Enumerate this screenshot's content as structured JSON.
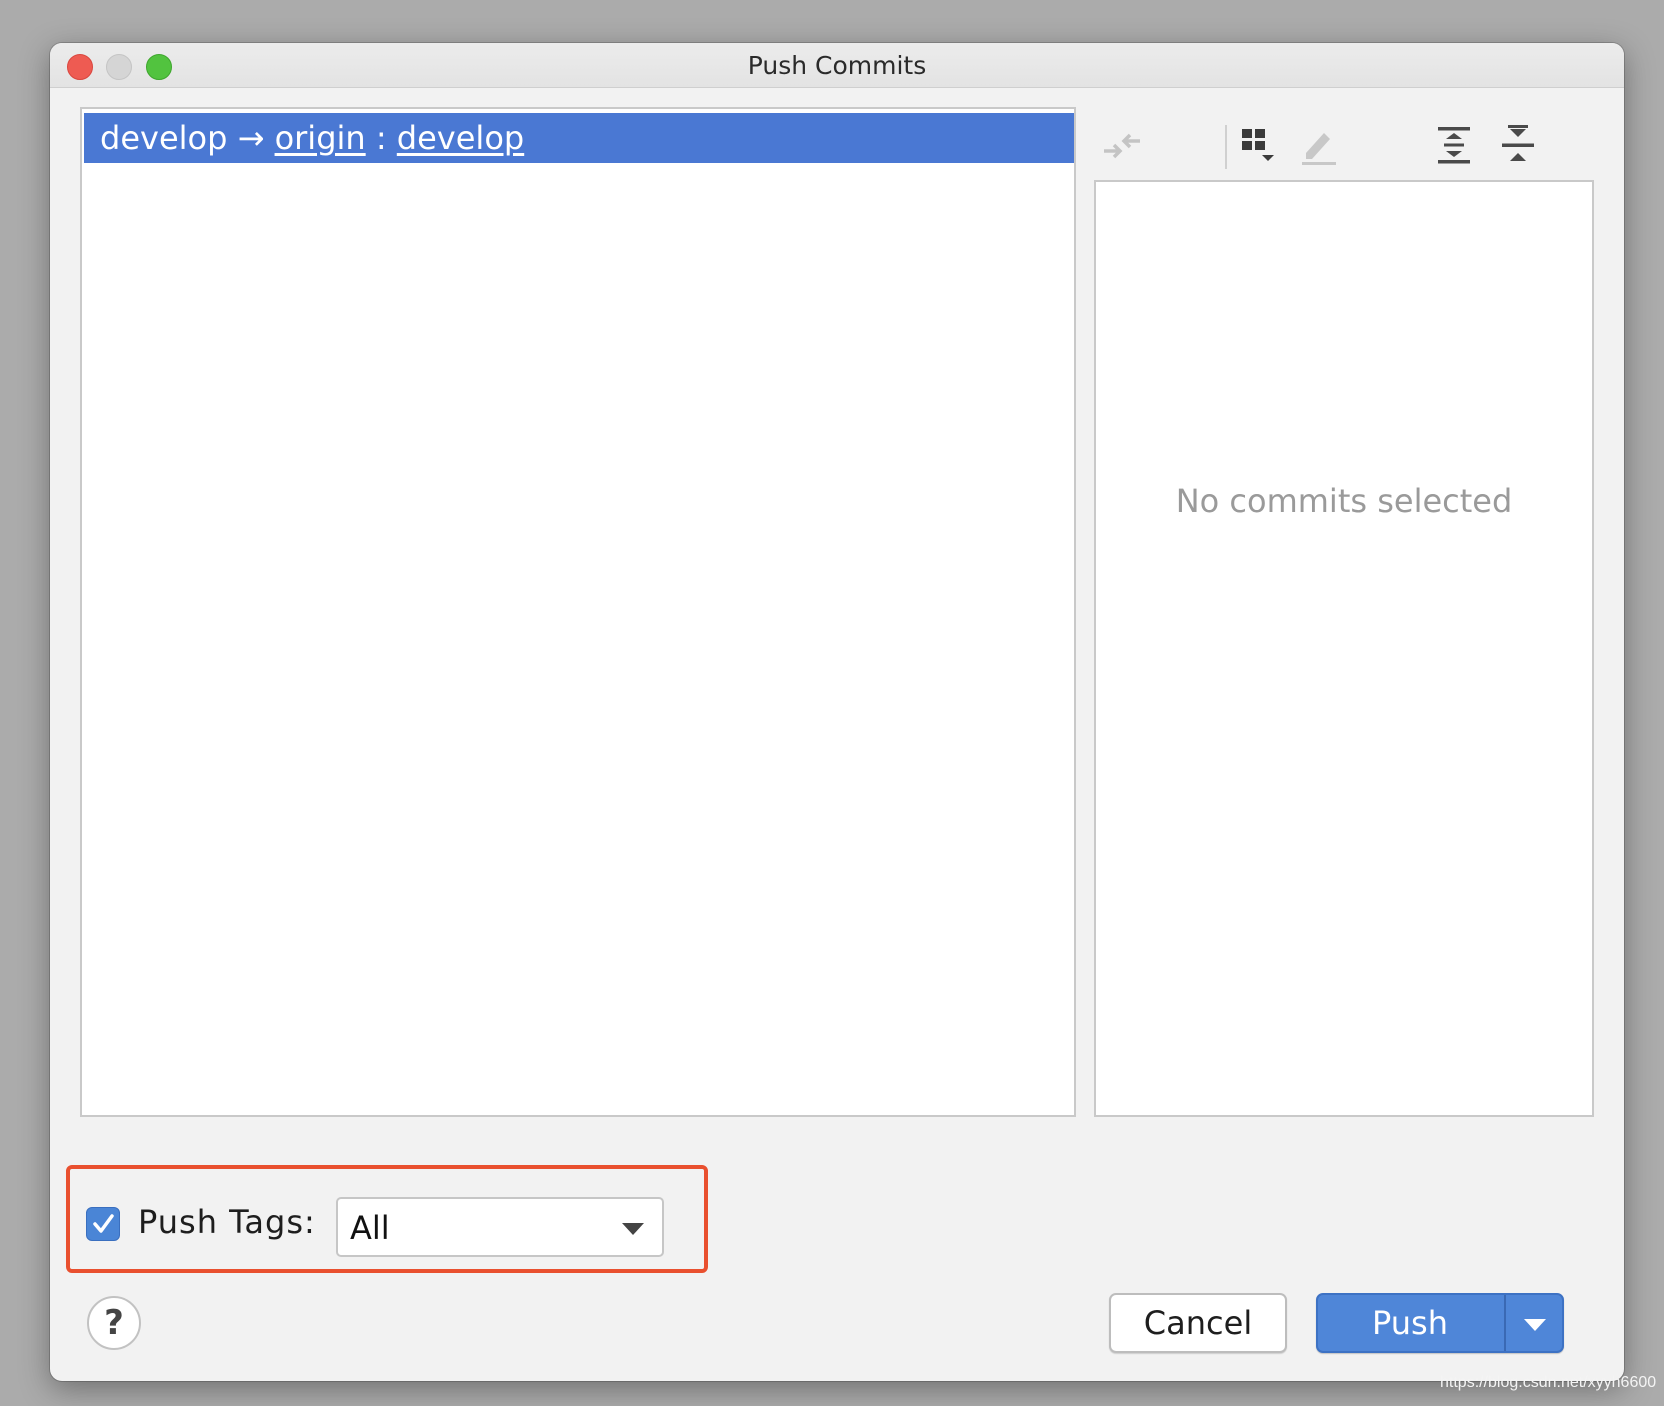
{
  "window": {
    "title": "Push Commits"
  },
  "branch": {
    "local": "develop",
    "arrow": "→",
    "remote": "origin",
    "separator": ":",
    "remote_branch": "develop"
  },
  "details": {
    "empty_message": "No commits selected"
  },
  "toolbar": {
    "icons": [
      "merge-arrows-icon",
      "grid-options-icon",
      "edit-pencil-icon",
      "expand-all-icon",
      "collapse-all-icon"
    ]
  },
  "push_tags": {
    "checked": true,
    "label": "Push Tags:",
    "selected": "All"
  },
  "buttons": {
    "help": "?",
    "cancel": "Cancel",
    "push": "Push"
  },
  "watermark": "https://blog.csdn.net/xyyh6600",
  "colors": {
    "selection": "#4a78d3",
    "primary_button": "#4f86d8",
    "highlight_box": "#e9502f"
  }
}
